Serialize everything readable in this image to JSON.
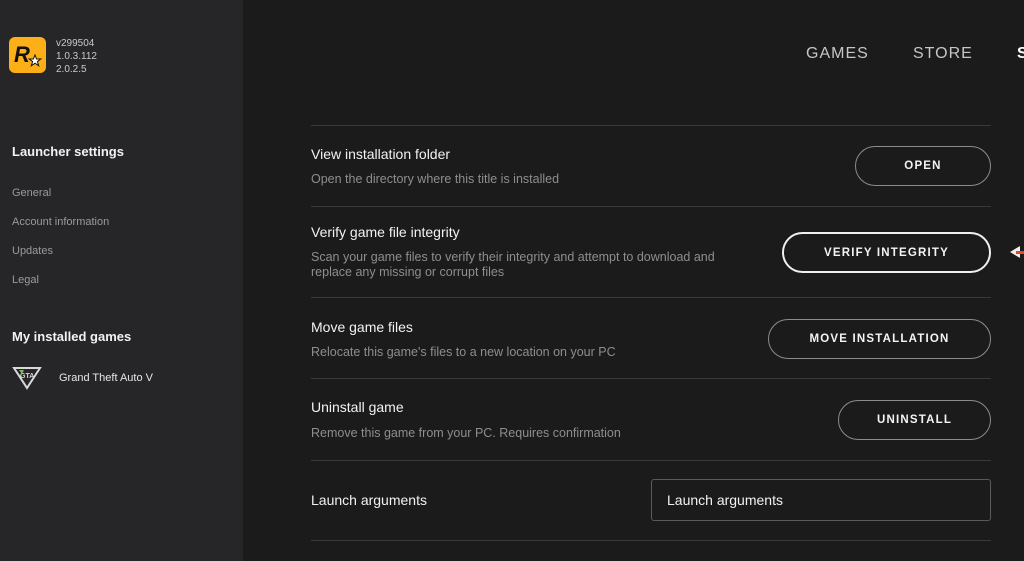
{
  "app": {
    "versions": [
      "v299504",
      "1.0.3.112",
      "2.0.2.5"
    ]
  },
  "nav": {
    "items": [
      "GAMES",
      "STORE",
      "S"
    ]
  },
  "sidebar": {
    "launcher_settings_heading": "Launcher settings",
    "links": [
      "General",
      "Account information",
      "Updates",
      "Legal"
    ],
    "installed_heading": "My installed games",
    "games": [
      {
        "name": "Grand Theft Auto V",
        "icon": "gta-v-icon"
      }
    ]
  },
  "settings": {
    "rows": [
      {
        "title": "View installation folder",
        "description": "Open the directory where this title is installed",
        "button": "OPEN"
      },
      {
        "title": "Verify game file integrity",
        "description": "Scan your game files to verify their integrity and attempt to download and replace any missing or corrupt files",
        "button": "VERIFY INTEGRITY"
      },
      {
        "title": "Move game files",
        "description": "Relocate this game's files to a new location on your PC",
        "button": "MOVE INSTALLATION"
      },
      {
        "title": "Uninstall game",
        "description": "Remove this game from your PC. Requires confirmation",
        "button": "UNINSTALL"
      }
    ],
    "launch_arguments": {
      "label": "Launch arguments",
      "placeholder": "Launch arguments"
    }
  },
  "colors": {
    "sidebar_bg": "#262628",
    "main_bg": "#1b1b1c",
    "logo_yellow": "#fcaf17",
    "pointer_accent": "#e24b2a"
  }
}
